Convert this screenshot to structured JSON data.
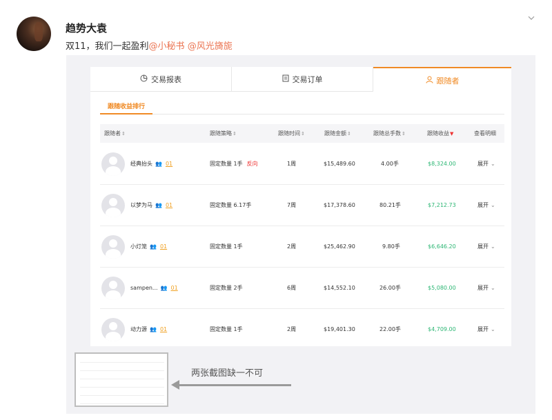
{
  "post": {
    "username": "趋势大袁",
    "text_prefix": "双11，我们一起盈利",
    "mention_1": "@小秘书",
    "mention_2": "@风光旖旎"
  },
  "tabs": [
    {
      "label": "交易报表",
      "icon": "pie-chart-icon"
    },
    {
      "label": "交易订单",
      "icon": "order-icon"
    },
    {
      "label": "跟随者",
      "icon": "user-icon"
    }
  ],
  "subtab": "跟随收益排行",
  "table": {
    "headers": [
      "跟随者",
      "跟随策略",
      "跟随时间",
      "跟随金额",
      "跟随总手数",
      "跟随收益",
      "查看明细"
    ],
    "rows": [
      {
        "name": "经典抬头",
        "followers": "01",
        "strategy": "固定数量",
        "lots": "1手",
        "tag": "反向",
        "time": "1周",
        "amount": "$15,489.60",
        "total": "4.00手",
        "profit": "$8,324.00",
        "detail": "展开"
      },
      {
        "name": "以梦为马",
        "followers": "01",
        "strategy": "固定数量",
        "lots": "6.17手",
        "tag": "",
        "time": "7周",
        "amount": "$17,378.60",
        "total": "80.21手",
        "profit": "$7,212.73",
        "detail": "展开"
      },
      {
        "name": "小灯笼",
        "followers": "01",
        "strategy": "固定数量",
        "lots": "1手",
        "tag": "",
        "time": "2周",
        "amount": "$25,462.90",
        "total": "9.80手",
        "profit": "$6,646.20",
        "detail": "展开"
      },
      {
        "name": "sampen...",
        "followers": "01",
        "strategy": "固定数量",
        "lots": "2手",
        "tag": "",
        "time": "6周",
        "amount": "$14,552.10",
        "total": "26.00手",
        "profit": "$5,080.00",
        "detail": "展开"
      },
      {
        "name": "动力源",
        "followers": "01",
        "strategy": "固定数量",
        "lots": "1手",
        "tag": "",
        "time": "2周",
        "amount": "$19,401.30",
        "total": "22.00手",
        "profit": "$4,709.00",
        "detail": "展开"
      }
    ]
  },
  "annotation": "两张截图缺一不可",
  "colors": {
    "accent": "#f08a24",
    "profit": "#2bb673",
    "mention": "#eb7350",
    "reverse": "#e33333"
  }
}
